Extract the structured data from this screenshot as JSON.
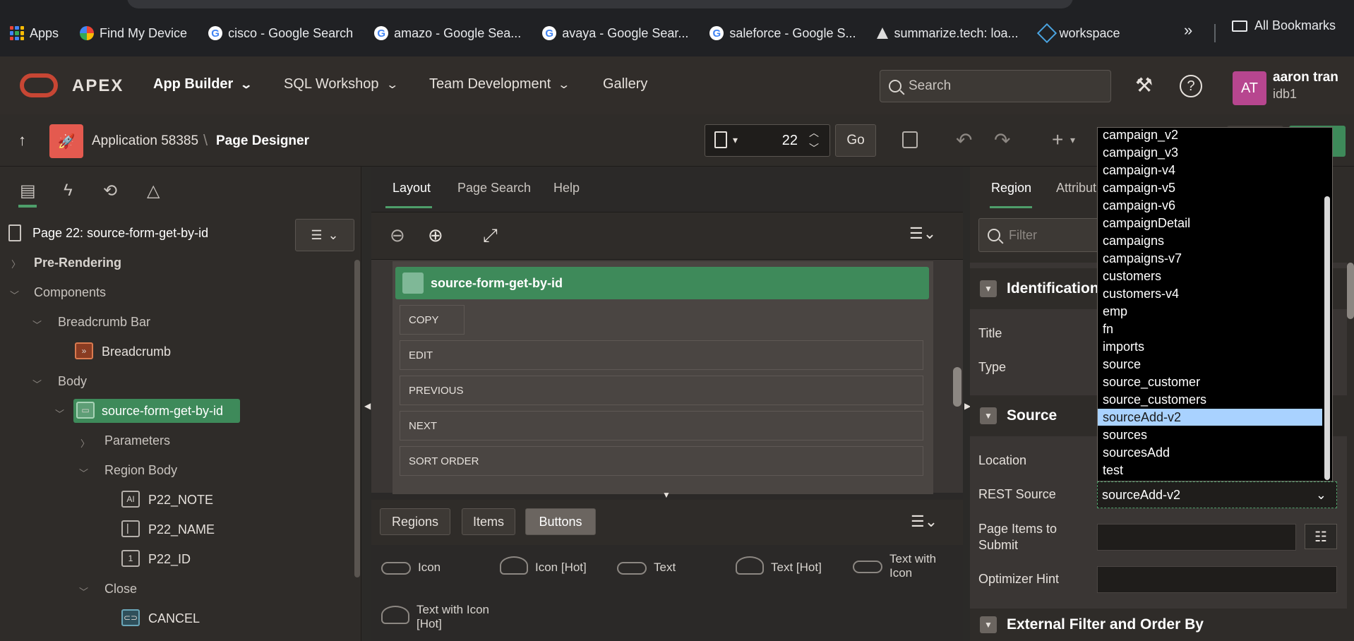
{
  "bookmarks": {
    "items": [
      {
        "label": "Apps",
        "icon": "apps-grid-icon"
      },
      {
        "label": "Find My Device",
        "icon": "find-device-icon"
      },
      {
        "label": "cisco - Google Search",
        "icon": "google-icon"
      },
      {
        "label": "amazo - Google Sea...",
        "icon": "google-icon"
      },
      {
        "label": "avaya - Google Sear...",
        "icon": "google-icon"
      },
      {
        "label": "saleforce - Google S...",
        "icon": "google-icon"
      },
      {
        "label": "summarize.tech: loa...",
        "icon": "summarize-icon"
      },
      {
        "label": "workspace",
        "icon": "workspace-icon"
      }
    ],
    "more": "»",
    "all_label": "All Bookmarks"
  },
  "header": {
    "brand": "APEX",
    "nav": [
      {
        "label": "App Builder",
        "bold": true
      },
      {
        "label": "SQL Workshop",
        "bold": false
      },
      {
        "label": "Team Development",
        "bold": false
      },
      {
        "label": "Gallery",
        "bold": false
      }
    ],
    "search_placeholder": "Search",
    "user": {
      "initials": "AT",
      "name": "aaron tran",
      "workspace": "idb1"
    }
  },
  "toolbar": {
    "app_crumb": "Application 58385",
    "crumb_sep": "\\",
    "title": "Page Designer",
    "page_number": "22",
    "go_label": "Go"
  },
  "left_panel": {
    "page_title": "Page 22: source-form-get-by-id",
    "tree": {
      "pre_rendering": "Pre-Rendering",
      "components": "Components",
      "breadcrumb_bar": "Breadcrumb Bar",
      "breadcrumb": "Breadcrumb",
      "body": "Body",
      "region": "source-form-get-by-id",
      "parameters": "Parameters",
      "region_body": "Region Body",
      "p22_note": "P22_NOTE",
      "p22_name": "P22_NAME",
      "p22_id": "P22_ID",
      "close": "Close",
      "cancel": "CANCEL"
    }
  },
  "middle_panel": {
    "tabs": [
      "Layout",
      "Page Search",
      "Help"
    ],
    "region_title": "source-form-get-by-id",
    "buttons": [
      "COPY",
      "EDIT",
      "PREVIOUS",
      "NEXT",
      "SORT ORDER"
    ],
    "gallery_tabs": [
      "Regions",
      "Items",
      "Buttons"
    ],
    "gallery": {
      "icon": "Icon",
      "icon_hot": "Icon [Hot]",
      "text": "Text",
      "text_hot": "Text [Hot]",
      "text_with_icon": "Text with Icon",
      "text_with_icon_hot": "Text with Icon [Hot]"
    }
  },
  "right_panel": {
    "tabs": [
      "Region",
      "Attribut"
    ],
    "filter_placeholder": "Filter",
    "sections": {
      "identification": "Identification",
      "source": "Source",
      "external": "External Filter and Order By"
    },
    "labels": {
      "title": "Title",
      "type": "Type",
      "location": "Location",
      "rest_source": "REST Source",
      "page_items_to_submit": "Page Items to Submit",
      "optimizer_hint": "Optimizer Hint"
    },
    "rest_source_value": "sourceAdd-v2"
  },
  "dropdown": {
    "options": [
      "campaign_v2",
      "campaign_v3",
      "campaign-v4",
      "campaign-v5",
      "campaign-v6",
      "campaignDetail",
      "campaigns",
      "campaigns-v7",
      "customers",
      "customers-v4",
      "emp",
      "fn",
      "imports",
      "source",
      "source_customer",
      "source_customers",
      "sourceAdd-v2",
      "sources",
      "sourcesAdd",
      "test"
    ],
    "selected": "sourceAdd-v2"
  },
  "colors": {
    "accent_green": "#3e8a5a",
    "oracle_red": "#c74634",
    "avatar": "#b7468f",
    "selected_option": "#a9d2ff"
  }
}
